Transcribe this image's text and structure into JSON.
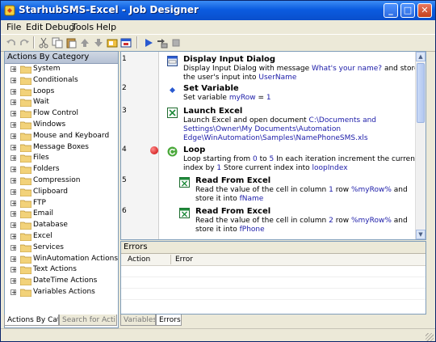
{
  "window": {
    "title": "StarhubSMS-Excel - Job Designer",
    "controls": {
      "minimize": "_",
      "maximize": "□",
      "close": "✕"
    }
  },
  "menu": [
    "File",
    "Edit",
    "Debug",
    "Tools",
    "Help"
  ],
  "toolbar_icons": [
    "undo-icon",
    "redo-icon",
    "cut-icon",
    "copy-icon",
    "paste-icon",
    "move-up-icon",
    "move-down-icon",
    "toggle-icon",
    "new-window-icon",
    "run-icon",
    "step-over-icon",
    "stop-icon"
  ],
  "left_panel": {
    "header": "Actions By Category",
    "categories": [
      "System",
      "Conditionals",
      "Loops",
      "Wait",
      "Flow Control",
      "Windows",
      "Mouse and Keyboard",
      "Message Boxes",
      "Files",
      "Folders",
      "Compression",
      "Clipboard",
      "FTP",
      "Email",
      "Database",
      "Excel",
      "Services",
      "WinAutomation Actions",
      "Text Actions",
      "DateTime Actions",
      "Variables Actions"
    ],
    "tabs": [
      "Actions By Cat...",
      "Search for Acti..."
    ]
  },
  "steps": [
    {
      "line": "1",
      "title": "Display Input Dialog",
      "icon": "input-dialog-icon",
      "description": [
        {
          "t": "Display Input Dialog with message "
        },
        {
          "t": "What's your name?",
          "h": true
        },
        {
          "t": " and store the user's input into "
        },
        {
          "t": "UserName",
          "h": true
        }
      ]
    },
    {
      "line": "2",
      "title": "Set Variable",
      "icon": "set-variable-icon",
      "description": [
        {
          "t": "Set variable "
        },
        {
          "t": "myRow",
          "h": true
        },
        {
          "t": " = "
        },
        {
          "t": "1",
          "h": true
        }
      ]
    },
    {
      "line": "3",
      "title": "Launch Excel",
      "icon": "launch-excel-icon",
      "description": [
        {
          "t": "Launch Excel and open document "
        },
        {
          "t": "C:\\Documents and Settings\\Owner\\My Documents\\Automation Edge\\WinAutomation\\Samples\\NamePhoneSMS.xls",
          "h": true
        }
      ]
    },
    {
      "line": "4",
      "title": "Loop",
      "icon": "loop-icon",
      "breakpoint": true,
      "description": [
        {
          "t": "Loop starting from "
        },
        {
          "t": "0",
          "h": true
        },
        {
          "t": " to "
        },
        {
          "t": "5",
          "h": true
        },
        {
          "t": " In each iteration increment the current index by "
        },
        {
          "t": "1",
          "h": true
        },
        {
          "t": " Store current index into "
        },
        {
          "t": "loopIndex",
          "h": true
        }
      ]
    },
    {
      "line": "5",
      "title": "Read From Excel",
      "icon": "read-excel-icon",
      "nested": true,
      "description": [
        {
          "t": "Read the value of the cell in column "
        },
        {
          "t": "1",
          "h": true
        },
        {
          "t": " row "
        },
        {
          "t": "%myRow%",
          "h": true
        },
        {
          "t": " and store it into "
        },
        {
          "t": "fName",
          "h": true
        }
      ]
    },
    {
      "line": "6",
      "title": "Read From Excel",
      "icon": "read-excel-icon",
      "nested": true,
      "description": [
        {
          "t": "Read the value of the cell in column "
        },
        {
          "t": "2",
          "h": true
        },
        {
          "t": " row "
        },
        {
          "t": "%myRow%",
          "h": true
        },
        {
          "t": " and store it into "
        },
        {
          "t": "fPhone",
          "h": true
        }
      ]
    }
  ],
  "errors_panel": {
    "title": "Errors",
    "columns": [
      "Action",
      "Error"
    ],
    "tabs": [
      "Variables",
      "Errors"
    ]
  },
  "colors": {
    "accent": "#0a4fcc",
    "highlight_text": "#1c1ca8",
    "breakpoint": "#c80000"
  }
}
